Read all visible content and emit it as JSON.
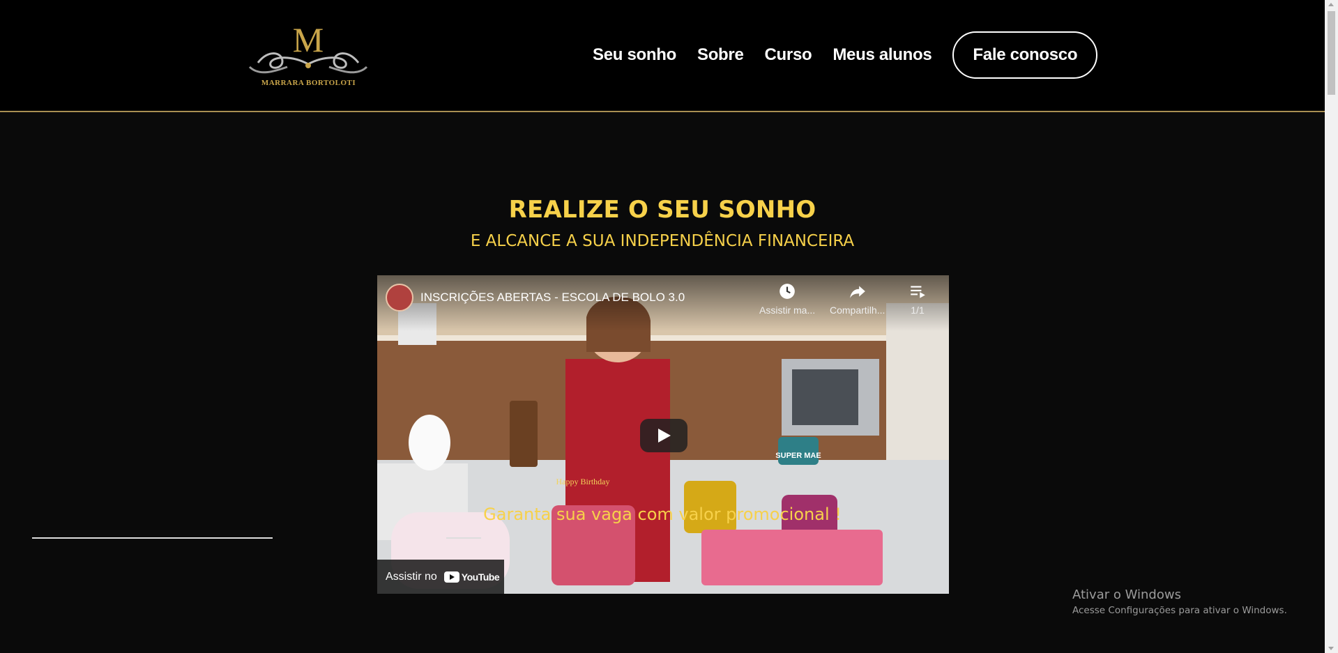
{
  "brand": {
    "logo_letter": "M",
    "logo_name": "MARRARA BORTOLOTI",
    "gold": "#c9a54a"
  },
  "nav": {
    "items": [
      {
        "label": "Seu sonho"
      },
      {
        "label": "Sobre"
      },
      {
        "label": "Curso"
      },
      {
        "label": "Meus alunos"
      }
    ],
    "cta_label": "Fale conosco"
  },
  "hero": {
    "headline": "REALIZE O SEU SONHO",
    "subheadline": "E ALCANCE A SUA INDEPENDÊNCIA FINANCEIRA",
    "accent_color": "#f7d14a"
  },
  "video": {
    "title": "INSCRIÇÕES ABERTAS - ESCOLA DE BOLO 3.0",
    "watch_later_label": "Assistir ma...",
    "share_label": "Compartilh...",
    "playlist_label": "1/1",
    "watch_on_label": "Assistir no",
    "youtube_label": "YouTube",
    "scene_sign": "SUPER MAE",
    "scene_topper": "Happy Birthday"
  },
  "promo": {
    "text": "Garanta sua vaga com valor promocional !"
  },
  "windows_watermark": {
    "title": "Ativar o Windows",
    "subtitle": "Acesse Configurações para ativar o Windows."
  }
}
